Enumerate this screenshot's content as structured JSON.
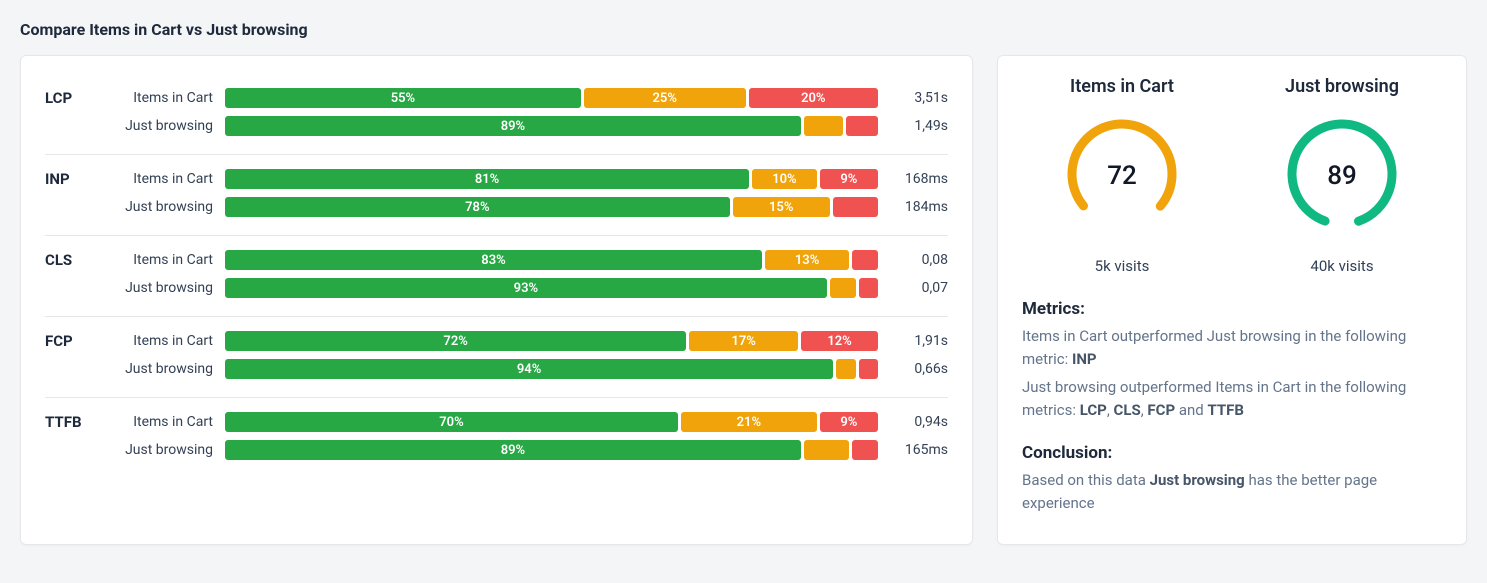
{
  "page": {
    "title": "Compare Items in Cart vs Just browsing"
  },
  "series_a_name": "Items in Cart",
  "series_b_name": "Just browsing",
  "colors": {
    "good": "#28a745",
    "warn": "#f0a30a",
    "bad": "#f05252"
  },
  "chart_data": [
    {
      "type": "bar",
      "metric": "LCP",
      "rows": [
        {
          "series": "Items in Cart",
          "good": 55,
          "warn": 25,
          "bad": 20,
          "good_label": "55%",
          "warn_label": "25%",
          "bad_label": "20%",
          "value": "3,51s"
        },
        {
          "series": "Just browsing",
          "good": 89,
          "warn": 6,
          "bad": 5,
          "good_label": "89%",
          "warn_label": "",
          "bad_label": "",
          "value": "1,49s"
        }
      ]
    },
    {
      "type": "bar",
      "metric": "INP",
      "rows": [
        {
          "series": "Items in Cart",
          "good": 81,
          "warn": 10,
          "bad": 9,
          "good_label": "81%",
          "warn_label": "10%",
          "bad_label": "9%",
          "value": "168ms"
        },
        {
          "series": "Just browsing",
          "good": 78,
          "warn": 15,
          "bad": 7,
          "good_label": "78%",
          "warn_label": "15%",
          "bad_label": "",
          "value": "184ms"
        }
      ]
    },
    {
      "type": "bar",
      "metric": "CLS",
      "rows": [
        {
          "series": "Items in Cart",
          "good": 83,
          "warn": 13,
          "bad": 4,
          "good_label": "83%",
          "warn_label": "13%",
          "bad_label": "",
          "value": "0,08"
        },
        {
          "series": "Just browsing",
          "good": 93,
          "warn": 4,
          "bad": 3,
          "good_label": "93%",
          "warn_label": "",
          "bad_label": "",
          "value": "0,07"
        }
      ]
    },
    {
      "type": "bar",
      "metric": "FCP",
      "rows": [
        {
          "series": "Items in Cart",
          "good": 72,
          "warn": 17,
          "bad": 12,
          "good_label": "72%",
          "warn_label": "17%",
          "bad_label": "12%",
          "value": "1,91s"
        },
        {
          "series": "Just browsing",
          "good": 94,
          "warn": 3,
          "bad": 3,
          "good_label": "94%",
          "warn_label": "",
          "bad_label": "",
          "value": "0,66s"
        }
      ]
    },
    {
      "type": "bar",
      "metric": "TTFB",
      "rows": [
        {
          "series": "Items in Cart",
          "good": 70,
          "warn": 21,
          "bad": 9,
          "good_label": "70%",
          "warn_label": "21%",
          "bad_label": "9%",
          "value": "0,94s"
        },
        {
          "series": "Just browsing",
          "good": 89,
          "warn": 7,
          "bad": 4,
          "good_label": "89%",
          "warn_label": "",
          "bad_label": "",
          "value": "165ms"
        }
      ]
    }
  ],
  "gauges": [
    {
      "title": "Items in Cart",
      "score": 72,
      "color": "#f0a30a",
      "visits": "5k visits"
    },
    {
      "title": "Just browsing",
      "score": 89,
      "color": "#10b981",
      "visits": "40k visits"
    }
  ],
  "summary": {
    "metrics_label": "Metrics:",
    "line1_prefix": "Items in Cart outperformed Just browsing in the following metric: ",
    "line1_bold": "INP",
    "line2_prefix": "Just browsing outperformed Items in Cart in the following metrics: ",
    "line2_bold1": "LCP",
    "line2_sep1": ", ",
    "line2_bold2": "CLS",
    "line2_sep2": ", ",
    "line2_bold3": "FCP",
    "line2_sep3": " and ",
    "line2_bold4": "TTFB",
    "conclusion_label": "Conclusion:",
    "conclusion_prefix": "Based on this data ",
    "conclusion_bold": "Just browsing",
    "conclusion_suffix": " has the better page experience"
  }
}
